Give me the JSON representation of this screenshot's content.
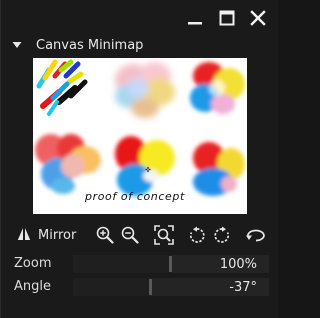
{
  "panel": {
    "title": "Canvas Minimap",
    "canvas_caption": "proof of concept"
  },
  "toolbar": {
    "mirror_label": "Mirror",
    "icons": [
      "mirror-icon",
      "zoom-in-icon",
      "zoom-out-icon",
      "zoom-to-fit-icon",
      "rotate-left-icon",
      "rotate-right-icon",
      "reset-view-icon"
    ]
  },
  "zoom": {
    "label": "Zoom",
    "value": "100%",
    "level": 0.5
  },
  "angle": {
    "label": "Angle",
    "value": "-37°",
    "level": 0.4
  },
  "colors": {
    "background": "#1a1a1a",
    "text": "#e6e6e6",
    "slider_track": "#242424",
    "slider_handle": "#5a5a5a"
  }
}
